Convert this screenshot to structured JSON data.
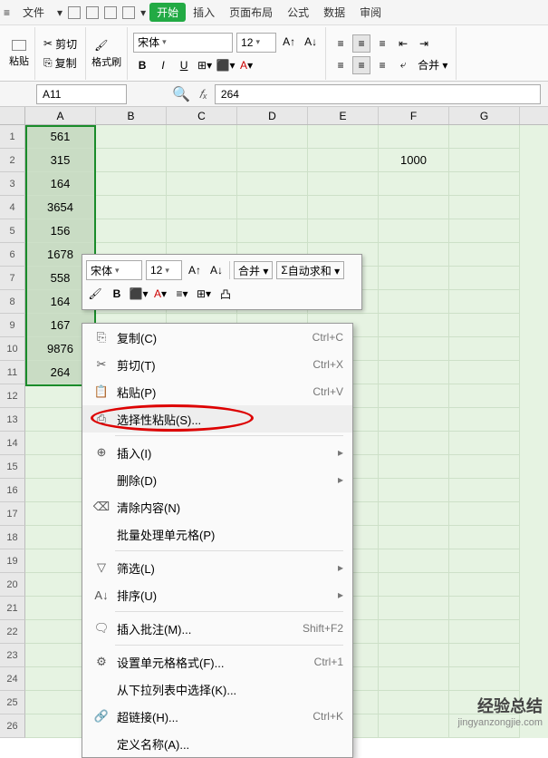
{
  "menu": {
    "file": "文件",
    "start": "开始",
    "insert": "插入",
    "layout": "页面布局",
    "formula": "公式",
    "data": "数据",
    "review": "审阅"
  },
  "clipboard": {
    "paste": "粘贴",
    "cut": "剪切",
    "copy": "复制",
    "format": "格式刷"
  },
  "font": {
    "name": "宋体",
    "size": "12",
    "merge": "合并 ▾"
  },
  "namebox": "A11",
  "fx": "264",
  "cols": [
    "A",
    "B",
    "C",
    "D",
    "E",
    "F",
    "G"
  ],
  "rows": [
    1,
    2,
    3,
    4,
    5,
    6,
    7,
    8,
    9,
    10,
    11,
    12,
    13,
    14,
    15,
    16,
    17,
    18,
    19,
    20,
    21,
    22,
    23,
    24,
    25,
    26
  ],
  "a_values": [
    "561",
    "315",
    "164",
    "3654",
    "156",
    "1678",
    "558",
    "164",
    "167",
    "9876",
    "264"
  ],
  "f2": "1000",
  "mini": {
    "font": "宋体",
    "size": "12",
    "merge": "合并 ▾",
    "sum": "自动求和 ▾"
  },
  "cm": {
    "copy": "复制(C)",
    "copy_sc": "Ctrl+C",
    "cut": "剪切(T)",
    "cut_sc": "Ctrl+X",
    "paste": "粘贴(P)",
    "paste_sc": "Ctrl+V",
    "pspecial": "选择性粘贴(S)...",
    "insert": "插入(I)",
    "delete": "删除(D)",
    "clear": "清除内容(N)",
    "batch": "批量处理单元格(P)",
    "filter": "筛选(L)",
    "sort": "排序(U)",
    "comment": "插入批注(M)...",
    "comment_sc": "Shift+F2",
    "format": "设置单元格格式(F)...",
    "format_sc": "Ctrl+1",
    "dropdown": "从下拉列表中选择(K)...",
    "link": "超链接(H)...",
    "link_sc": "Ctrl+K",
    "define": "定义名称(A)..."
  },
  "watermark": {
    "title": "经验总结",
    "url": "jingyanzongjie.com"
  }
}
